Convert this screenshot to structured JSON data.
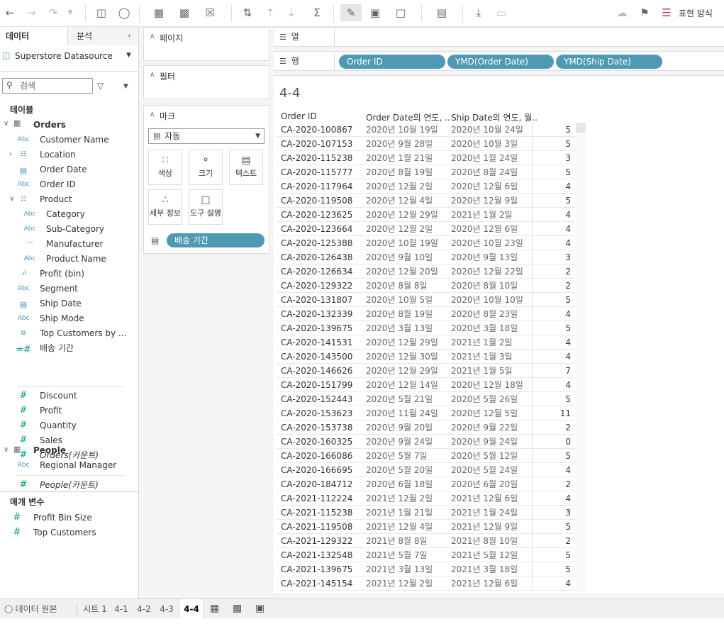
{
  "toolbar": {
    "right_label": "표현 방식"
  },
  "left": {
    "tab_data": "데이터",
    "tab_analysis": "분석",
    "datasource": "Superstore Datasource",
    "search_placeholder": "검색",
    "tables_title": "테이블",
    "orders_label": "Orders",
    "orders_fields": [
      {
        "name": "Customer Name",
        "type": "Abc"
      },
      {
        "name": "Location",
        "type": "hier"
      },
      {
        "name": "Order Date",
        "type": "cal"
      },
      {
        "name": "Order ID",
        "type": "Abc"
      },
      {
        "name": "Product",
        "type": "hier"
      },
      {
        "name": "Category",
        "type": "Abc"
      },
      {
        "name": "Sub-Category",
        "type": "Abc"
      },
      {
        "name": "Manufacturer",
        "type": "clip"
      },
      {
        "name": "Product Name",
        "type": "Abc"
      },
      {
        "name": "Profit (bin)",
        "type": "bin"
      },
      {
        "name": "Segment",
        "type": "Abc"
      },
      {
        "name": "Ship Date",
        "type": "cal"
      },
      {
        "name": "Ship Mode",
        "type": "Abc"
      },
      {
        "name": "Top Customers by ...",
        "type": "set"
      },
      {
        "name": "배송 기간",
        "type": "calc"
      }
    ],
    "orders_measures": [
      "Discount",
      "Profit",
      "Quantity",
      "Sales",
      "Orders(카운트)"
    ],
    "people_label": "People",
    "people_fields": [
      "Regional Manager"
    ],
    "people_measures": [
      "People(카운트)"
    ],
    "params_title": "매개 변수",
    "params": [
      "Profit Bin Size",
      "Top Customers"
    ]
  },
  "mid": {
    "pages_title": "페이지",
    "filters_title": "필터",
    "marks_title": "마크",
    "mark_type": "자동",
    "btn_color": "색상",
    "btn_size": "크기",
    "btn_text": "텍스트",
    "btn_detail": "세부 정보",
    "btn_tooltip": "도구 설명",
    "text_pill": "배송 기간"
  },
  "shelves": {
    "columns_label": "열",
    "rows_label": "행",
    "row_pills": [
      "Order ID",
      "YMD(Order Date)",
      "YMD(Ship Date)"
    ]
  },
  "view": {
    "title": "4-4",
    "headers": [
      "Order ID",
      "Order Date의 연도, ..",
      "Ship Date의 연도, 월.."
    ],
    "rows": [
      [
        "CA-2020-100867",
        "2020년 10월 19일",
        "2020년 10월 24일",
        "5"
      ],
      [
        "CA-2020-107153",
        "2020년 9월 28일",
        "2020년 10월 3일",
        "5"
      ],
      [
        "CA-2020-115238",
        "2020년 1월 21일",
        "2020년 1월 24일",
        "3"
      ],
      [
        "CA-2020-115777",
        "2020년 8월 19일",
        "2020년 8월 24일",
        "5"
      ],
      [
        "CA-2020-117964",
        "2020년 12월 2일",
        "2020년 12월 6일",
        "4"
      ],
      [
        "CA-2020-119508",
        "2020년 12월 4일",
        "2020년 12월 9일",
        "5"
      ],
      [
        "CA-2020-123625",
        "2020년 12월 29일",
        "2021년 1월 2일",
        "4"
      ],
      [
        "CA-2020-123664",
        "2020년 12월 2일",
        "2020년 12월 6일",
        "4"
      ],
      [
        "CA-2020-125388",
        "2020년 10월 19일",
        "2020년 10월 23일",
        "4"
      ],
      [
        "CA-2020-126438",
        "2020년 9월 10일",
        "2020년 9월 13일",
        "3"
      ],
      [
        "CA-2020-126634",
        "2020년 12월 20일",
        "2020년 12월 22일",
        "2"
      ],
      [
        "CA-2020-129322",
        "2020년 8월 8일",
        "2020년 8월 10일",
        "2"
      ],
      [
        "CA-2020-131807",
        "2020년 10월 5일",
        "2020년 10월 10일",
        "5"
      ],
      [
        "CA-2020-132339",
        "2020년 8월 19일",
        "2020년 8월 23일",
        "4"
      ],
      [
        "CA-2020-139675",
        "2020년 3월 13일",
        "2020년 3월 18일",
        "5"
      ],
      [
        "CA-2020-141531",
        "2020년 12월 29일",
        "2021년 1월 2일",
        "4"
      ],
      [
        "CA-2020-143500",
        "2020년 12월 30일",
        "2021년 1월 3일",
        "4"
      ],
      [
        "CA-2020-146626",
        "2020년 12월 29일",
        "2021년 1월 5일",
        "7"
      ],
      [
        "CA-2020-151799",
        "2020년 12월 14일",
        "2020년 12월 18일",
        "4"
      ],
      [
        "CA-2020-152443",
        "2020년 5월 21일",
        "2020년 5월 26일",
        "5"
      ],
      [
        "CA-2020-153623",
        "2020년 11월 24일",
        "2020년 12월 5일",
        "11"
      ],
      [
        "CA-2020-153738",
        "2020년 9월 20일",
        "2020년 9월 22일",
        "2"
      ],
      [
        "CA-2020-160325",
        "2020년 9월 24일",
        "2020년 9월 24일",
        "0"
      ],
      [
        "CA-2020-166086",
        "2020년 5월 7일",
        "2020년 5월 12일",
        "5"
      ],
      [
        "CA-2020-166695",
        "2020년 5월 20일",
        "2020년 5월 24일",
        "4"
      ],
      [
        "CA-2020-184712",
        "2020년 6월 18일",
        "2020년 6월 20일",
        "2"
      ],
      [
        "CA-2021-112224",
        "2021년 12월 2일",
        "2021년 12월 6일",
        "4"
      ],
      [
        "CA-2021-115238",
        "2021년 1월 21일",
        "2021년 1월 24일",
        "3"
      ],
      [
        "CA-2021-119508",
        "2021년 12월 4일",
        "2021년 12월 9일",
        "5"
      ],
      [
        "CA-2021-129322",
        "2021년 8월 8일",
        "2021년 8월 10일",
        "2"
      ],
      [
        "CA-2021-132548",
        "2021년 5월 7일",
        "2021년 5월 12일",
        "5"
      ],
      [
        "CA-2021-139675",
        "2021년 3월 13일",
        "2021년 3월 18일",
        "5"
      ],
      [
        "CA-2021-145154",
        "2021년 12월 2일",
        "2021년 12월 6일",
        "4"
      ]
    ]
  },
  "bottom": {
    "datasource_tab": "데이터 원본",
    "sheet_tabs": [
      "시트 1",
      "4-1",
      "4-2",
      "4-3",
      "4-4"
    ],
    "active_tab": "4-4"
  }
}
